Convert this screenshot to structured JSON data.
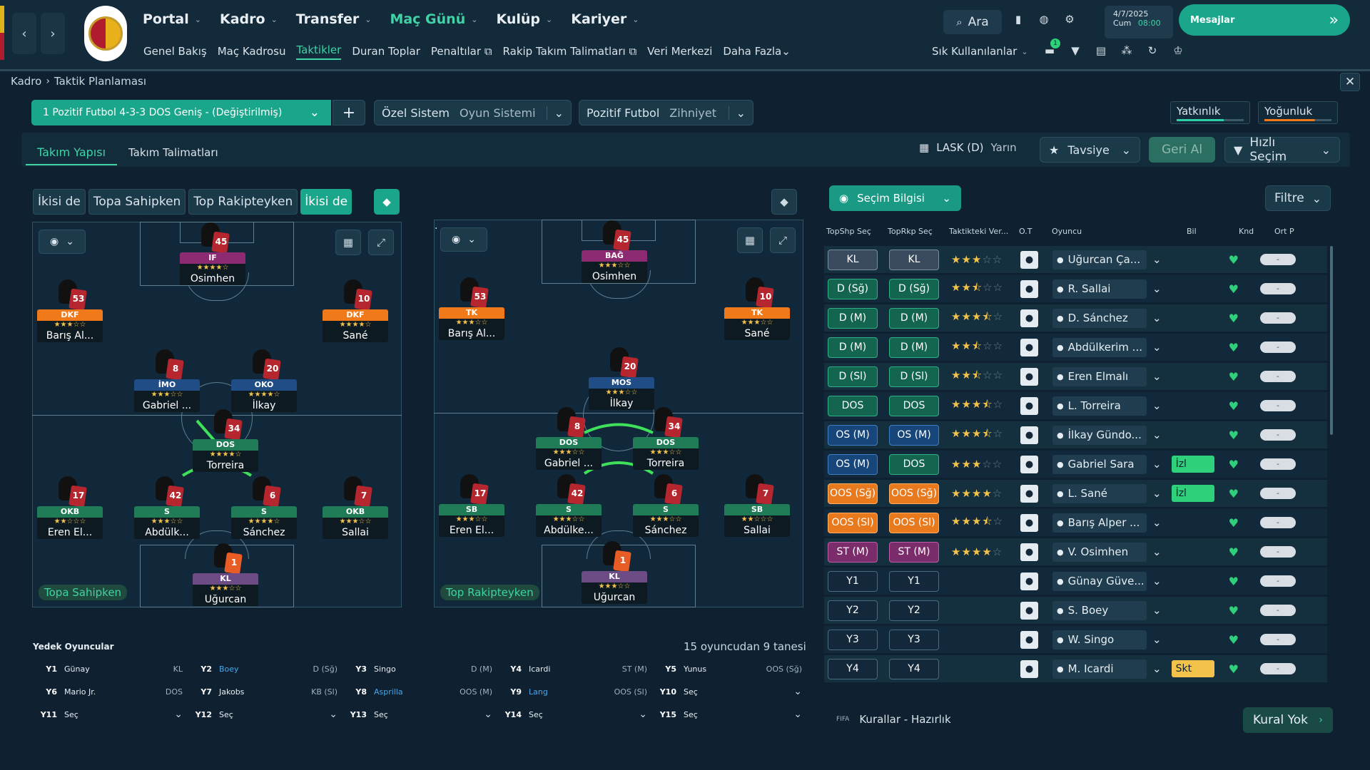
{
  "nav": {
    "menus": [
      {
        "label": "Portal",
        "active": false
      },
      {
        "label": "Kadro",
        "active": false
      },
      {
        "label": "Transfer",
        "active": false
      },
      {
        "label": "Maç Günü",
        "active": true
      },
      {
        "label": "Kulüp",
        "active": false
      },
      {
        "label": "Kariyer",
        "active": false
      }
    ],
    "submenu": [
      "Genel Bakış",
      "Maç Kadrosu",
      "Taktikler",
      "Duran Toplar",
      "Penaltılar",
      "Rakip Takım Talimatları",
      "Veri Merkezi",
      "Daha Fazla"
    ],
    "search": "Ara",
    "date": "4/7/2025",
    "day": "Cum",
    "time": "08:00",
    "messages": "Mesajlar",
    "frequent": "Sık Kullanılanlar",
    "notif_count": "1"
  },
  "breadcrumb": {
    "root": "Kadro",
    "current": "Taktik Planlaması"
  },
  "tactic": {
    "name": "1  Pozitif Futbol 4-3-3 DOS Geniş - (Değiştirilmiş)",
    "system_value": "Özel Sistem",
    "system_label": "Oyun Sistemi",
    "mentality_value": "Pozitif Futbol",
    "mentality_label": "Zihniyet",
    "fam": "Yatkınlık",
    "intensity": "Yoğunluk"
  },
  "tabs": [
    "Takım Yapısı",
    "Takım Talimatları"
  ],
  "match": {
    "opponent": "LASK (D)",
    "when": "Yarın",
    "advice": "Tavsiye",
    "undo": "Geri Al",
    "quick": "Hızlı Seçim"
  },
  "phase_tabs": [
    "İkisi de",
    "Topa Sahipken",
    "Top Rakipteyken",
    "İkisi de"
  ],
  "pitch_left_label": "Topa Sahipken",
  "pitch_right_label": "Top Rakipteyken",
  "pitch_left": [
    {
      "num": "45",
      "role": "IF",
      "color": "p",
      "stars": "★★★★☆",
      "name": "Osimhen"
    },
    {
      "num": "53",
      "role": "DKF",
      "color": "o",
      "stars": "★★★☆☆",
      "name": "Barış Al..."
    },
    {
      "num": "10",
      "role": "DKF",
      "color": "o",
      "stars": "★★★★☆",
      "name": "Sané"
    },
    {
      "num": "8",
      "role": "İMO",
      "color": "b",
      "stars": "★★★☆☆",
      "name": "Gabriel ..."
    },
    {
      "num": "20",
      "role": "OKO",
      "color": "b",
      "stars": "★★★★☆",
      "name": "İlkay"
    },
    {
      "num": "34",
      "role": "DOS",
      "color": "g",
      "stars": "★★★★☆",
      "name": "Torreira"
    },
    {
      "num": "17",
      "role": "OKB",
      "color": "g",
      "stars": "★★☆☆☆",
      "name": "Eren El..."
    },
    {
      "num": "42",
      "role": "S",
      "color": "g",
      "stars": "★★★☆☆",
      "name": "Abdülk..."
    },
    {
      "num": "6",
      "role": "S",
      "color": "g",
      "stars": "★★★★☆",
      "name": "Sánchez"
    },
    {
      "num": "7",
      "role": "OKB",
      "color": "g",
      "stars": "★★★☆☆",
      "name": "Sallai"
    },
    {
      "num": "1",
      "role": "KL",
      "color": "s",
      "stars": "★★★☆☆",
      "name": "Uğurcan"
    }
  ],
  "pitch_right": [
    {
      "num": "45",
      "role": "BAĞ",
      "color": "p",
      "stars": "★★★☆☆",
      "name": "Osimhen"
    },
    {
      "num": "53",
      "role": "TK",
      "color": "o",
      "stars": "★★★☆☆",
      "name": "Barış Al..."
    },
    {
      "num": "10",
      "role": "TK",
      "color": "o",
      "stars": "★★★☆☆",
      "name": "Sané"
    },
    {
      "num": "20",
      "role": "MOS",
      "color": "b",
      "stars": "★★★☆☆",
      "name": "İlkay"
    },
    {
      "num": "8",
      "role": "DOS",
      "color": "g",
      "stars": "★★★☆☆",
      "name": "Gabriel ..."
    },
    {
      "num": "34",
      "role": "DOS",
      "color": "g",
      "stars": "★★★☆☆",
      "name": "Torreira"
    },
    {
      "num": "17",
      "role": "SB",
      "color": "g",
      "stars": "★★★☆☆",
      "name": "Eren El..."
    },
    {
      "num": "42",
      "role": "S",
      "color": "g",
      "stars": "★★★☆☆",
      "name": "Abdülke..."
    },
    {
      "num": "6",
      "role": "S",
      "color": "g",
      "stars": "★★★☆☆",
      "name": "Sánchez"
    },
    {
      "num": "7",
      "role": "SB",
      "color": "g",
      "stars": "★★☆☆☆",
      "name": "Sallai"
    },
    {
      "num": "1",
      "role": "KL",
      "color": "s",
      "stars": "★★★☆☆",
      "name": "Uğurcan"
    }
  ],
  "subs": {
    "title": "Yedek Oyuncular",
    "count": "15 oyuncudan 9 tanesi",
    "rows": [
      [
        {
          "s": "Y1",
          "n": "Günay",
          "p": "KL",
          "b": false
        },
        {
          "s": "Y2",
          "n": "Boey",
          "p": "D (Sğ)",
          "b": true
        },
        {
          "s": "Y3",
          "n": "Singo",
          "p": "D (M)",
          "b": false
        },
        {
          "s": "Y4",
          "n": "Icardi",
          "p": "ST (M)",
          "b": false
        },
        {
          "s": "Y5",
          "n": "Yunus",
          "p": "OOS (Sğ)",
          "b": false
        }
      ],
      [
        {
          "s": "Y6",
          "n": "Mario Jr.",
          "p": "DOS",
          "b": false
        },
        {
          "s": "Y7",
          "n": "Jakobs",
          "p": "KB (Sl)",
          "b": false
        },
        {
          "s": "Y8",
          "n": "Asprilla",
          "p": "OOS (M)",
          "b": true
        },
        {
          "s": "Y9",
          "n": "Lang",
          "p": "OOS (Sl)",
          "b": true
        },
        {
          "s": "Y10",
          "n": "Seç",
          "p": "",
          "b": false
        }
      ],
      [
        {
          "s": "Y11",
          "n": "Seç",
          "p": "",
          "b": false
        },
        {
          "s": "Y12",
          "n": "Seç",
          "p": "",
          "b": false
        },
        {
          "s": "Y13",
          "n": "Seç",
          "p": "",
          "b": false
        },
        {
          "s": "Y14",
          "n": "Seç",
          "p": "",
          "b": false
        },
        {
          "s": "Y15",
          "n": "Seç",
          "p": "",
          "b": false
        }
      ]
    ]
  },
  "selection": {
    "button": "Seçim Bilgisi",
    "filter": "Filtre"
  },
  "table": {
    "headers": [
      "TopShp Seç",
      "TopRkp Seç",
      "Taktikteki Ver...",
      "O.T",
      "Oyuncu",
      "Bil",
      "Knd",
      "Ort P"
    ],
    "rows": [
      {
        "a": "KL",
        "b": "KL",
        "ca": "kl",
        "cb": "kl",
        "st": 3,
        "half": false,
        "name": "Uğurcan Ça...",
        "badge": "",
        "bc": ""
      },
      {
        "a": "D (Sğ)",
        "b": "D (Sğ)",
        "ca": "d",
        "cb": "d",
        "st": 2,
        "half": true,
        "name": "R. Sallai",
        "badge": "",
        "bc": ""
      },
      {
        "a": "D (M)",
        "b": "D (M)",
        "ca": "d",
        "cb": "d",
        "st": 3,
        "half": true,
        "name": "D. Sánchez",
        "badge": "",
        "bc": ""
      },
      {
        "a": "D (M)",
        "b": "D (M)",
        "ca": "d",
        "cb": "d",
        "st": 2,
        "half": true,
        "name": "Abdülkerim ...",
        "badge": "",
        "bc": ""
      },
      {
        "a": "D (Sl)",
        "b": "D (Sl)",
        "ca": "d",
        "cb": "d",
        "st": 2,
        "half": true,
        "name": "Eren Elmalı",
        "badge": "",
        "bc": ""
      },
      {
        "a": "DOS",
        "b": "DOS",
        "ca": "dos",
        "cb": "dos",
        "st": 3,
        "half": true,
        "name": "L. Torreira",
        "badge": "",
        "bc": ""
      },
      {
        "a": "OS (M)",
        "b": "OS (M)",
        "ca": "os",
        "cb": "os",
        "st": 3,
        "half": true,
        "name": "İlkay Gündo...",
        "badge": "",
        "bc": ""
      },
      {
        "a": "OS (M)",
        "b": "DOS",
        "ca": "os",
        "cb": "dos",
        "st": 3,
        "half": false,
        "name": "Gabriel Sara",
        "badge": "İzl",
        "bc": "g"
      },
      {
        "a": "OOS (Sğ)",
        "b": "OOS (Sğ)",
        "ca": "oos",
        "cb": "oos",
        "st": 4,
        "half": false,
        "name": "L. Sané",
        "badge": "İzl",
        "bc": "g"
      },
      {
        "a": "OOS (Sl)",
        "b": "OOS (Sl)",
        "ca": "oos",
        "cb": "oos",
        "st": 3,
        "half": true,
        "name": "Barış Alper ...",
        "badge": "",
        "bc": ""
      },
      {
        "a": "ST (M)",
        "b": "ST (M)",
        "ca": "st",
        "cb": "st",
        "st": 4,
        "half": false,
        "name": "V. Osimhen",
        "badge": "",
        "bc": ""
      },
      {
        "a": "Y1",
        "b": "Y1",
        "ca": "y",
        "cb": "y",
        "st": 0,
        "half": false,
        "name": "Günay Güve...",
        "badge": "",
        "bc": ""
      },
      {
        "a": "Y2",
        "b": "Y2",
        "ca": "y",
        "cb": "y",
        "st": 0,
        "half": false,
        "name": "S. Boey",
        "badge": "",
        "bc": ""
      },
      {
        "a": "Y3",
        "b": "Y3",
        "ca": "y",
        "cb": "y",
        "st": 0,
        "half": false,
        "name": "W. Singo",
        "badge": "",
        "bc": ""
      },
      {
        "a": "Y4",
        "b": "Y4",
        "ca": "y",
        "cb": "y",
        "st": 0,
        "half": false,
        "name": "M. Icardi",
        "badge": "Skt",
        "bc": "y"
      }
    ],
    "avg": "-"
  },
  "footer": {
    "rules": "Kurallar - Hazırlık",
    "no_rule": "Kural Yok"
  }
}
